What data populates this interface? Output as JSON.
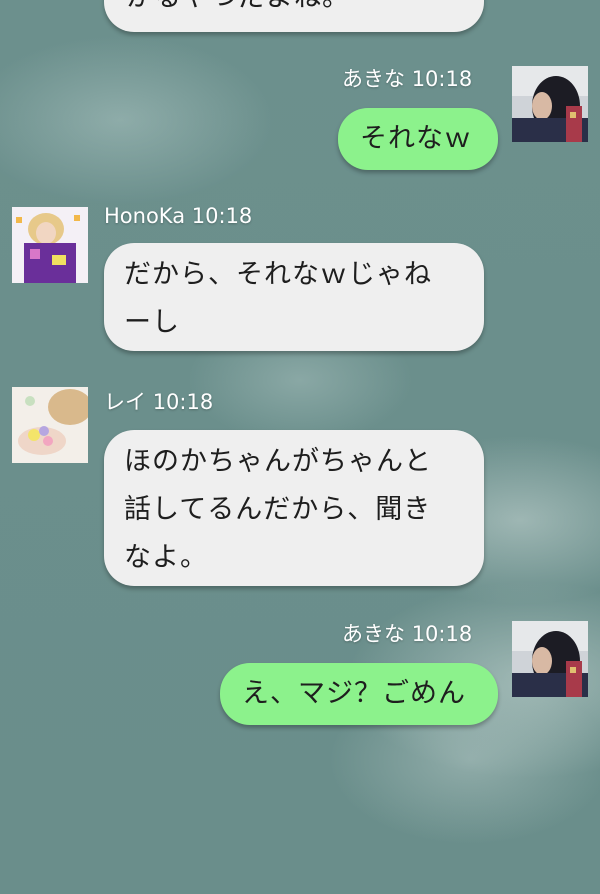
{
  "messages": [
    {
      "id": "m0",
      "sender": "",
      "time": "",
      "side": "left",
      "lines": [
        "かるやつだよね。"
      ]
    },
    {
      "id": "m1",
      "sender": "あきな",
      "time": "10:18",
      "side": "right",
      "lines": [
        "それなｗ"
      ]
    },
    {
      "id": "m2",
      "sender": "HonoKa",
      "time": "10:18",
      "side": "left",
      "lines": [
        "だから、それなｗじゃね",
        "ーし"
      ]
    },
    {
      "id": "m3",
      "sender": "レイ",
      "time": "10:18",
      "side": "left",
      "lines": [
        "ほのかちゃんがちゃんと",
        "話してるんだから、聞き",
        "なよ。"
      ]
    },
    {
      "id": "m4",
      "sender": "あきな",
      "time": "10:18",
      "side": "right",
      "lines": [
        "え、マジ？ごめん"
      ]
    }
  ],
  "colors": {
    "background": "#6a8e8b",
    "bubble_incoming": "#efefef",
    "bubble_outgoing": "#8cf28c"
  }
}
